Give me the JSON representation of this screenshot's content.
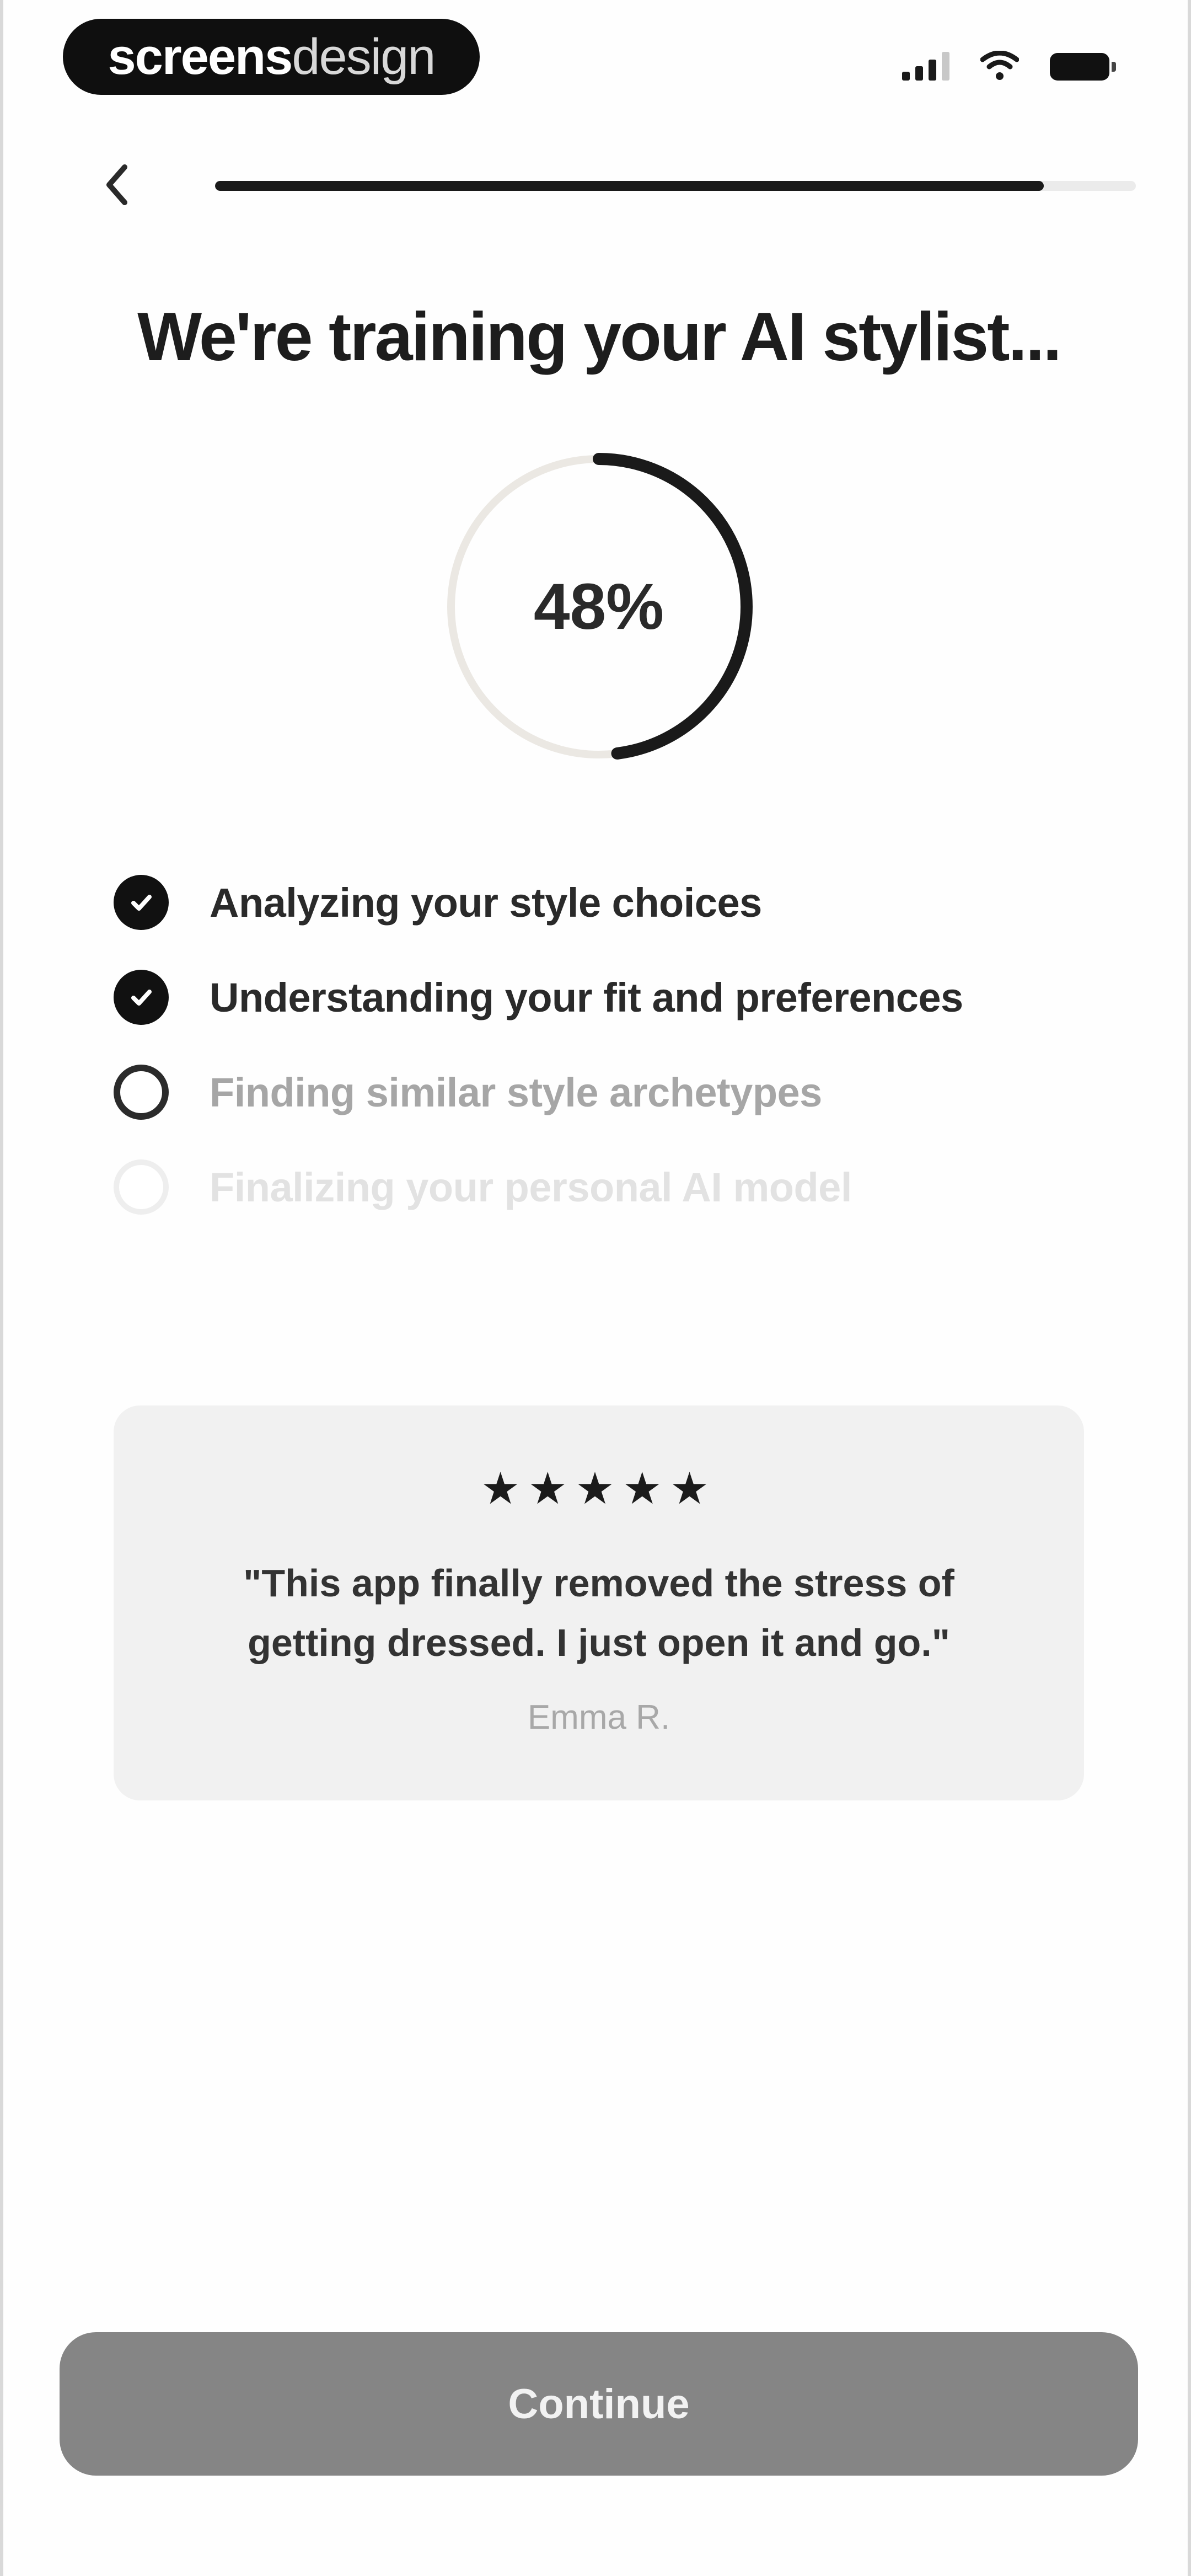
{
  "status_bar": {
    "brand_bold": "screens",
    "brand_light": "design"
  },
  "header": {
    "back_icon": "chevron-left-icon",
    "progress": 0.9
  },
  "title": "We're training your AI stylist...",
  "training": {
    "percent": 48,
    "percent_label": "48%"
  },
  "steps": [
    {
      "label": "Analyzing your style choices",
      "state": "done"
    },
    {
      "label": "Understanding your fit and preferences",
      "state": "done"
    },
    {
      "label": "Finding similar style archetypes",
      "state": "active"
    },
    {
      "label": "Finalizing your personal AI model",
      "state": "pending"
    }
  ],
  "testimonial": {
    "rating": 5,
    "stars": "★★★★★",
    "quote": "\"This app finally removed the stress of getting dressed. I just open it and go.\"",
    "author": "Emma R."
  },
  "cta": {
    "label": "Continue"
  },
  "colors": {
    "ink": "#1a1a1a",
    "ring_track": "#ebe8e3",
    "button_disabled": "#858585",
    "card_bg": "#f1f1f1"
  }
}
